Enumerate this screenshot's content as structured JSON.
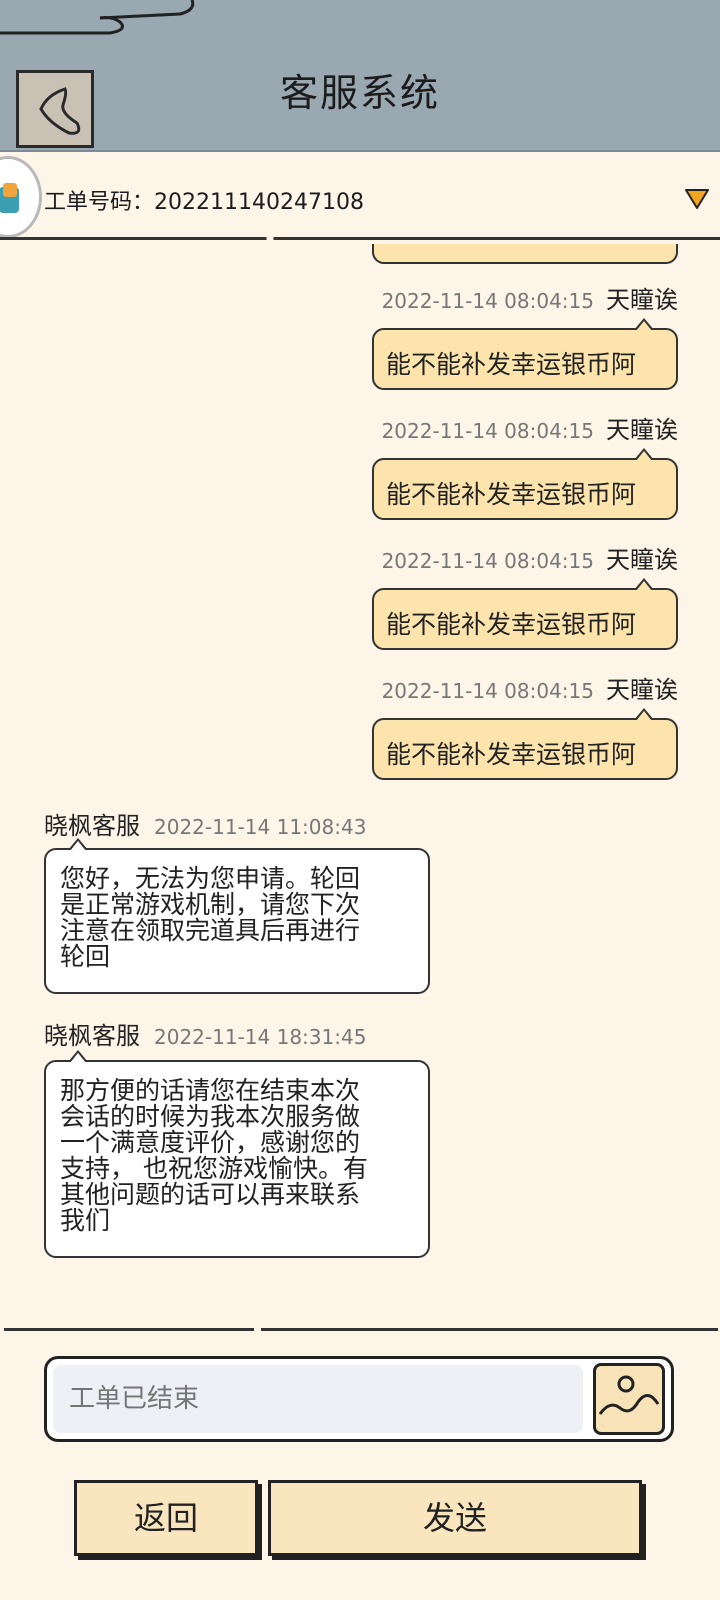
{
  "header": {
    "title": "客服系统"
  },
  "ticket": {
    "label": "工单号码：202211140247108"
  },
  "messages": [
    {
      "direction": "out",
      "time": "2022-11-14 08:04:15",
      "name": "天瞳诶",
      "text": "能不能补发幸运银币阿"
    },
    {
      "direction": "out",
      "time": "2022-11-14 08:04:15",
      "name": "天瞳诶",
      "text": "能不能补发幸运银币阿"
    },
    {
      "direction": "out",
      "time": "2022-11-14 08:04:15",
      "name": "天瞳诶",
      "text": "能不能补发幸运银币阿"
    },
    {
      "direction": "out",
      "time": "2022-11-14 08:04:15",
      "name": "天瞳诶",
      "text": "能不能补发幸运银币阿"
    },
    {
      "direction": "in",
      "time": "2022-11-14 11:08:43",
      "name": "晓枫客服",
      "lines": [
        "您好，无法为您申请。轮回",
        "是正常游戏机制，请您下次",
        "注意在领取完道具后再进行",
        "轮回"
      ]
    },
    {
      "direction": "in",
      "time": "2022-11-14 18:31:45",
      "name": "晓枫客服",
      "lines": [
        "那方便的话请您在结束本次",
        "会话的时候为我本次服务做",
        "一个满意度评价，感谢您的",
        "支持，  也祝您游戏愉快。有",
        "其他问题的话可以再来联系",
        "我们"
      ]
    }
  ],
  "input": {
    "placeholder": "工单已结束"
  },
  "buttons": {
    "back_label": "返回",
    "send_label": "发送"
  },
  "icons": {
    "back": "chevron-left-icon",
    "dropdown": "triangle-down-icon",
    "image": "image-icon"
  },
  "colors": {
    "header_bg": "#9aa8b2",
    "page_bg": "#fdf6e8",
    "out_bubble": "#fde4ad",
    "dropdown": "#f2a51e"
  }
}
